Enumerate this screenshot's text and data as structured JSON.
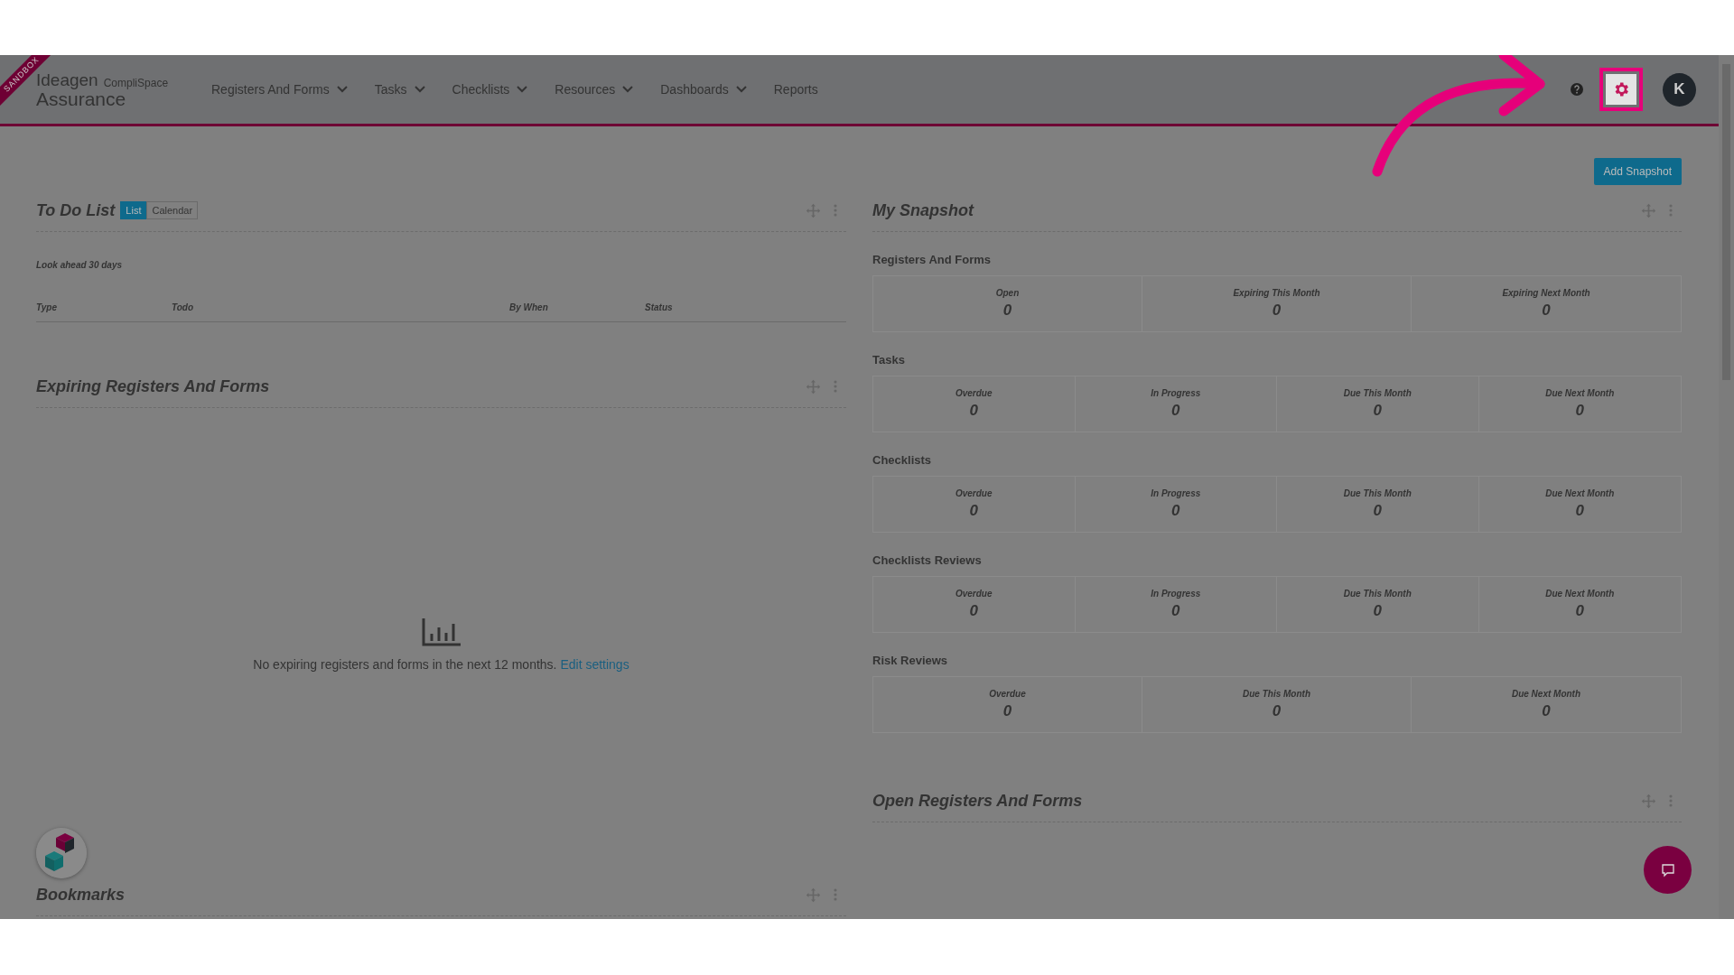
{
  "header": {
    "ribbon": "SANDBOX",
    "logo": {
      "brand": "Ideagen",
      "product": "CompliSpace",
      "name": "Assurance"
    },
    "nav": [
      {
        "label": "Registers And Forms",
        "dropdown": true
      },
      {
        "label": "Tasks",
        "dropdown": true
      },
      {
        "label": "Checklists",
        "dropdown": true
      },
      {
        "label": "Resources",
        "dropdown": true
      },
      {
        "label": "Dashboards",
        "dropdown": true
      },
      {
        "label": "Reports",
        "dropdown": false
      }
    ],
    "settings": {
      "highlighted": true
    },
    "avatar": "K"
  },
  "add_snapshot": "Add Snapshot",
  "todo": {
    "title": "To Do List",
    "tabs": [
      {
        "label": "List",
        "selected": true
      },
      {
        "label": "Calendar",
        "selected": false
      }
    ],
    "look_ahead": "Look ahead 30 days",
    "columns": [
      "Type",
      "Todo",
      "By When",
      "Status"
    ]
  },
  "expiring": {
    "title": "Expiring Registers And Forms",
    "message": "No expiring registers and forms in the next 12 months.",
    "link": "Edit settings"
  },
  "bookmarks": {
    "title": "Bookmarks"
  },
  "snapshot": {
    "title": "My Snapshot",
    "sections": [
      {
        "title": "Registers And Forms",
        "cells": [
          {
            "label": "Open",
            "value": "0"
          },
          {
            "label": "Expiring This Month",
            "value": "0"
          },
          {
            "label": "Expiring Next Month",
            "value": "0"
          }
        ]
      },
      {
        "title": "Tasks",
        "cells": [
          {
            "label": "Overdue",
            "value": "0"
          },
          {
            "label": "In Progress",
            "value": "0"
          },
          {
            "label": "Due This Month",
            "value": "0"
          },
          {
            "label": "Due Next Month",
            "value": "0"
          }
        ]
      },
      {
        "title": "Checklists",
        "cells": [
          {
            "label": "Overdue",
            "value": "0"
          },
          {
            "label": "In Progress",
            "value": "0"
          },
          {
            "label": "Due This Month",
            "value": "0"
          },
          {
            "label": "Due Next Month",
            "value": "0"
          }
        ]
      },
      {
        "title": "Checklists Reviews",
        "cells": [
          {
            "label": "Overdue",
            "value": "0"
          },
          {
            "label": "In Progress",
            "value": "0"
          },
          {
            "label": "Due This Month",
            "value": "0"
          },
          {
            "label": "Due Next Month",
            "value": "0"
          }
        ]
      },
      {
        "title": "Risk Reviews",
        "cells": [
          {
            "label": "Overdue",
            "value": "0"
          },
          {
            "label": "Due This Month",
            "value": "0"
          },
          {
            "label": "Due Next Month",
            "value": "0"
          }
        ]
      }
    ]
  },
  "open_registers": {
    "title": "Open Registers And Forms"
  }
}
